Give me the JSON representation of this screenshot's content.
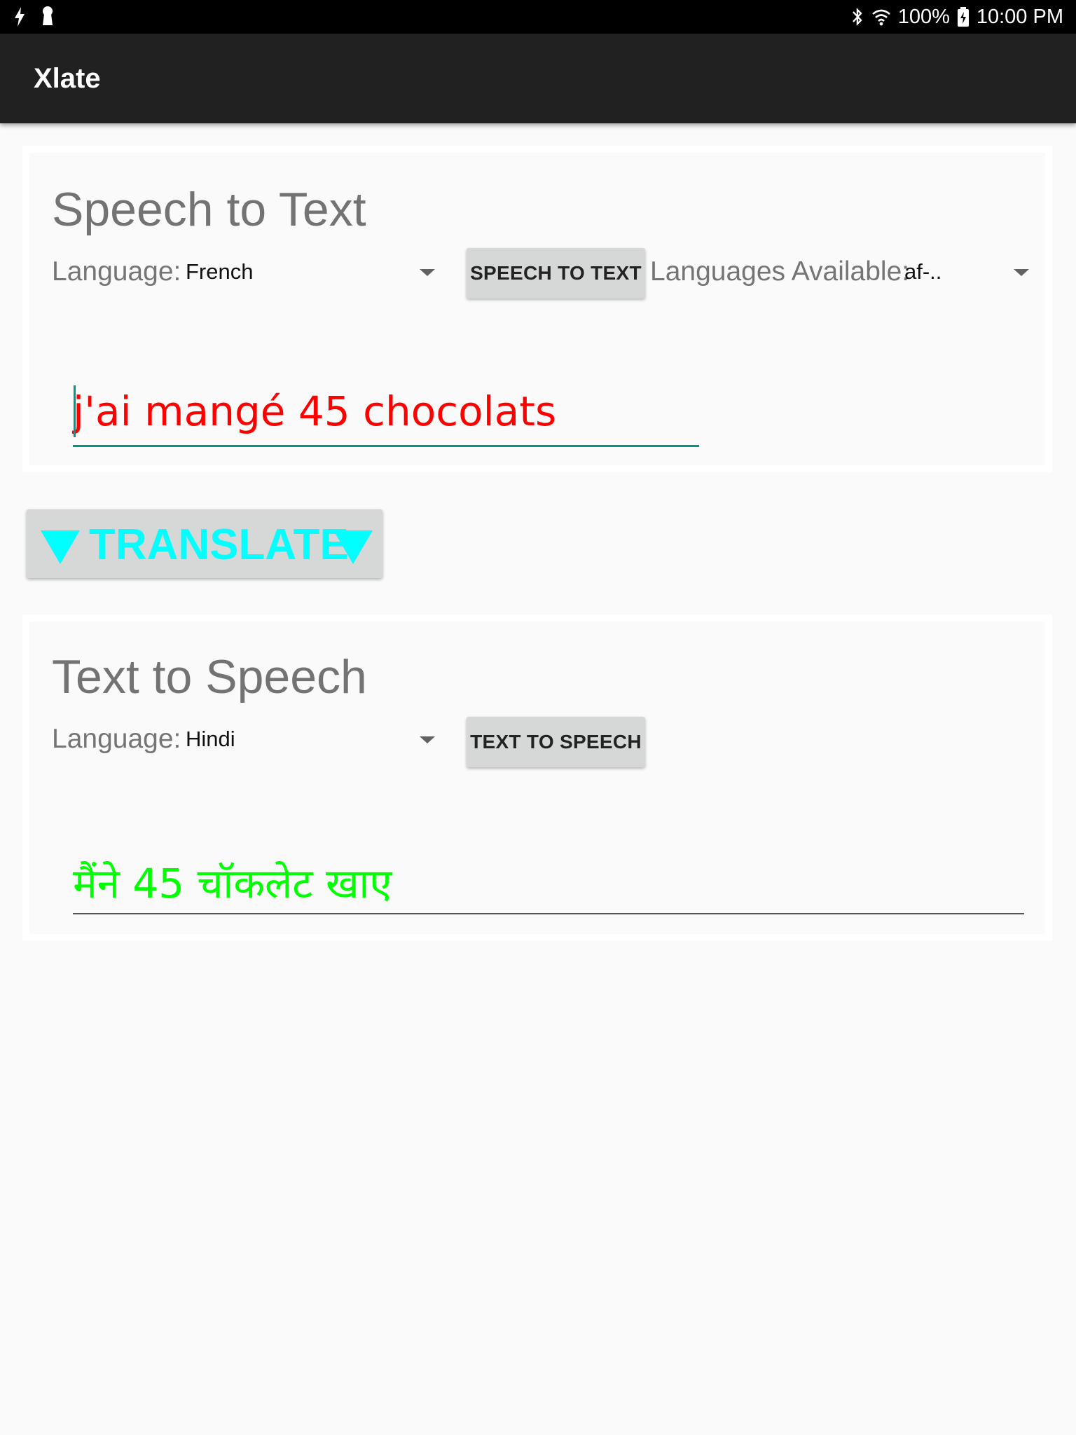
{
  "status_bar": {
    "battery_percent": "100%",
    "time": "10:00 PM",
    "left_icons": [
      "flash-icon",
      "keyhole-icon"
    ],
    "right_icons": [
      "bluetooth-icon",
      "wifi-icon",
      "battery-charging-icon"
    ]
  },
  "app_bar": {
    "title": "Xlate"
  },
  "speech_to_text": {
    "title": "Speech to Text",
    "language_label": "Language:",
    "language_value": "French",
    "button_label": "SPEECH TO TEXT",
    "languages_available_label": "Languages Available:",
    "languages_available_value": "af-..",
    "recognized_text": "j'ai mangé 45 chocolats",
    "text_color": "#ff0000"
  },
  "translate": {
    "label": "TRANSLATE",
    "color": "#00ffff",
    "left_icon": "triangle-down-icon",
    "right_icon": "triangle-down-icon"
  },
  "text_to_speech": {
    "title": "Text to Speech",
    "language_label": "Language:",
    "language_value": "Hindi",
    "button_label": "TEXT TO SPEECH",
    "translated_text": "मैंने 45 चॉकलेट खाए",
    "text_color": "#00ff00"
  },
  "colors": {
    "accent": "#009688",
    "app_bar": "#212121",
    "background": "#fafafa"
  }
}
